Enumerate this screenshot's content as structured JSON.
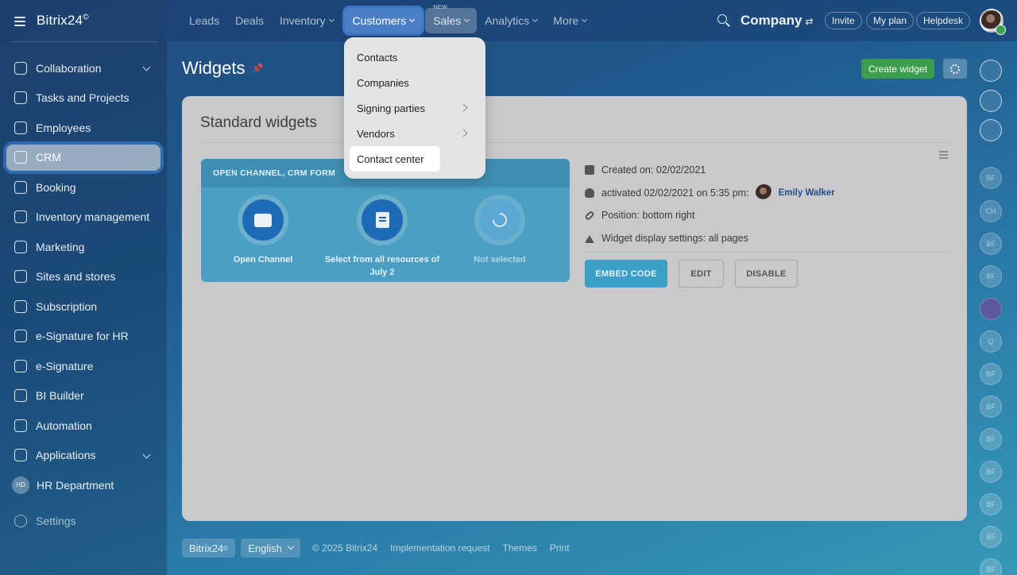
{
  "app": {
    "logo": "Bitrix24",
    "logo_mark": "©"
  },
  "sidebar": {
    "items": [
      {
        "label": "Collaboration",
        "icon": "collaboration-icon",
        "chevron": true
      },
      {
        "label": "Tasks and Projects",
        "icon": "tasks-icon"
      },
      {
        "label": "Employees",
        "icon": "employees-icon"
      },
      {
        "label": "CRM",
        "icon": "crm-icon",
        "active": true
      },
      {
        "label": "Booking",
        "icon": "booking-icon"
      },
      {
        "label": "Inventory management",
        "icon": "inventory-icon"
      },
      {
        "label": "Marketing",
        "icon": "marketing-icon"
      },
      {
        "label": "Sites and stores",
        "icon": "cart-icon"
      },
      {
        "label": "Subscription",
        "icon": "subscription-icon"
      },
      {
        "label": "e-Signature for HR",
        "icon": "signature-hr-icon"
      },
      {
        "label": "e-Signature",
        "icon": "signature-icon"
      },
      {
        "label": "BI Builder",
        "icon": "bi-builder-icon"
      },
      {
        "label": "Automation",
        "icon": "automation-icon"
      },
      {
        "label": "Applications",
        "icon": "applications-icon",
        "chevron": true
      },
      {
        "label": "HR Department",
        "badge": "HD"
      }
    ],
    "settings_label": "Settings"
  },
  "topnav": {
    "items": [
      {
        "label": "Leads"
      },
      {
        "label": "Deals"
      },
      {
        "label": "Inventory",
        "caret": true
      },
      {
        "label": "Customers",
        "caret": true,
        "active": true
      },
      {
        "label": "Sales",
        "caret": true,
        "badge": "NEW"
      },
      {
        "label": "Analytics",
        "caret": true
      },
      {
        "label": "More",
        "caret": true
      }
    ],
    "company": "Company",
    "invite": "Invite",
    "my_plan": "My plan",
    "helpdesk": "Helpdesk"
  },
  "page": {
    "title": "Widgets",
    "create_button": "Create widget"
  },
  "panel": {
    "title": "Standard widgets",
    "widget": {
      "header": "OPEN CHANNEL, CRM FORM",
      "items": [
        {
          "label": "Open Channel",
          "icon": "chat-icon"
        },
        {
          "label": "Select from all resources of July 2",
          "icon": "form-icon"
        },
        {
          "label": "Not selected",
          "icon": "phone-icon",
          "dim": true
        }
      ]
    },
    "info": {
      "created_label": "Created on:",
      "created_value": "02/02/2021",
      "activated_text": "activated 02/02/2021 on 5:35 pm:",
      "activated_user": "Emily Walker",
      "position_label": "Position:",
      "position_value": "bottom right",
      "display_label": "Widget display settings:",
      "display_value": "all pages"
    },
    "buttons": {
      "embed": "EMBED CODE",
      "edit": "EDIT",
      "disable": "DISABLE"
    }
  },
  "dropdown": {
    "items": [
      {
        "label": "Contacts"
      },
      {
        "label": "Companies"
      },
      {
        "label": "Signing parties",
        "submenu": true
      },
      {
        "label": "Vendors",
        "submenu": true
      },
      {
        "label": "Contact center",
        "highlighted": true
      }
    ]
  },
  "footer": {
    "brand": "Bitrix24",
    "language": "English",
    "copyright": "© 2025 Bitrix24",
    "implementation": "Implementation request",
    "themes": "Themes",
    "print": "Print"
  },
  "rightbar": {
    "icons": [
      "bell-icon",
      "target-icon",
      "chat-bubble-icon"
    ],
    "avatars": [
      "BF",
      "CH",
      "BF",
      "BF",
      "",
      "Q",
      "BF",
      "BF",
      "BF",
      "BF",
      "BF",
      "BF",
      "BF"
    ]
  },
  "colors": {
    "accent_green": "#3b9e4c",
    "active_nav": "#4a7fc6",
    "link_blue": "#1f4e8c"
  }
}
